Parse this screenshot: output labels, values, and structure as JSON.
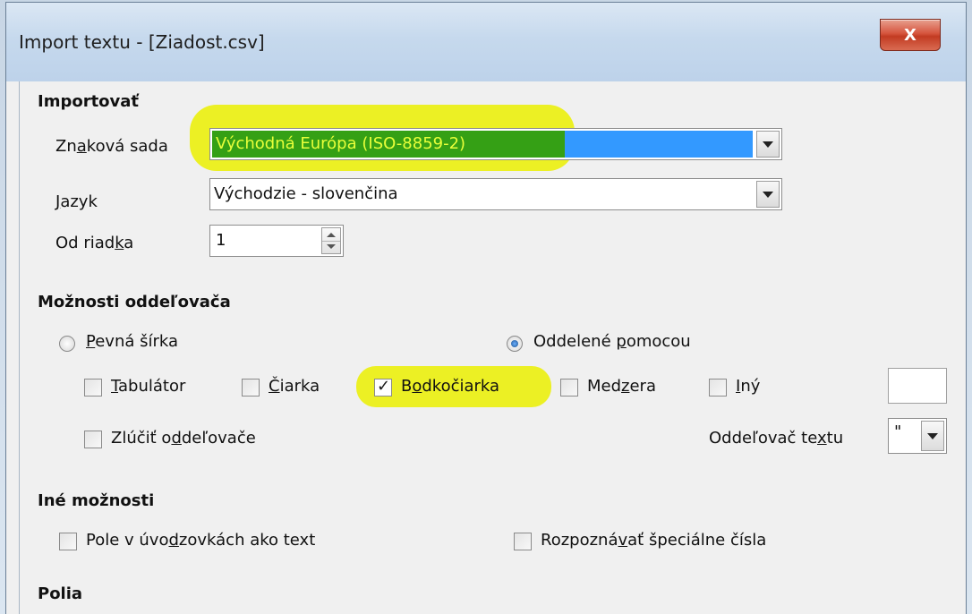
{
  "window": {
    "title": "Import textu - [Ziadost.csv]",
    "close_label": "X"
  },
  "import_section": {
    "heading": "Importovať",
    "charset": {
      "label_pre": "Zn",
      "label_u": "a",
      "label_post": "ková sada",
      "value": "Východná Európa (ISO-8859-2)"
    },
    "language": {
      "label_pre": "",
      "label_u": "J",
      "label_post": "azyk",
      "value": "Východzie - slovenčina"
    },
    "from_row": {
      "label_pre": "Od riad",
      "label_u": "k",
      "label_post": "a",
      "value": "1"
    }
  },
  "separator_section": {
    "heading": "Možnosti oddeľovača",
    "fixed_width": {
      "label_u": "P",
      "label_post": "evná šírka",
      "selected": false
    },
    "separated_by": {
      "label_pre": "Oddelené ",
      "label_u": "p",
      "label_post": "omocou",
      "selected": true
    },
    "tab": {
      "label_u": "T",
      "label_post": "abulátor",
      "checked": false
    },
    "comma": {
      "label_u": "Č",
      "label_post": "iarka",
      "checked": false
    },
    "semicolon": {
      "label_pre": "B",
      "label_u": "o",
      "label_post": "dkočiarka",
      "checked": true
    },
    "space": {
      "label_pre": "Med",
      "label_u": "z",
      "label_post": "era",
      "checked": false
    },
    "other": {
      "label_u": "I",
      "label_post": "ný",
      "checked": false,
      "value": ""
    },
    "merge": {
      "label_pre": "Zlúčiť o",
      "label_u": "d",
      "label_post": "deľovače",
      "checked": false
    },
    "text_delimiter": {
      "label_pre": "Oddeľovač te",
      "label_u": "x",
      "label_post": "tu",
      "value": "\""
    }
  },
  "other_section": {
    "heading": "Iné možnosti",
    "quoted_as_text": {
      "label_pre": "Pole v úvo",
      "label_u": "d",
      "label_post": "zovkách ako text",
      "checked": false
    },
    "detect_special": {
      "label_pre": "Rozpozná",
      "label_u": "v",
      "label_post": "ať špeciálne čísla",
      "checked": false
    }
  },
  "fields_section": {
    "heading": "Polia"
  },
  "colors": {
    "selection_blue": "#3399ff",
    "highlight_yellow": "#ebf000",
    "highlight_green": "#35a015"
  }
}
